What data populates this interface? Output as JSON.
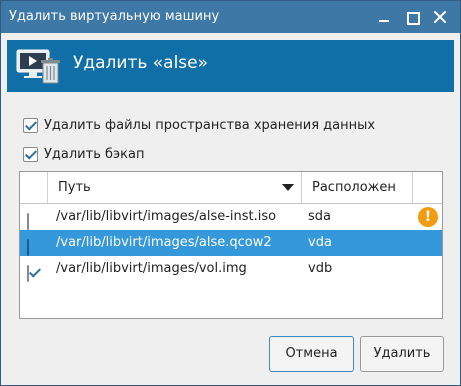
{
  "window": {
    "title": "Удалить виртуальную машину"
  },
  "header": {
    "title": "Удалить «alse»",
    "icon": "vm-delete-icon"
  },
  "options": [
    {
      "label": "Удалить файлы пространства хранения данных",
      "checked": true
    },
    {
      "label": "Удалить бэкап",
      "checked": true
    }
  ],
  "table": {
    "columns": [
      "Путь",
      "Расположен"
    ],
    "rows": [
      {
        "path": "/var/lib/libvirt/images/alse-inst.iso",
        "target": "sda",
        "checked": false,
        "selected": false,
        "warning": "!"
      },
      {
        "path": "/var/lib/libvirt/images/alse.qcow2",
        "target": "vda",
        "checked": false,
        "selected": true
      },
      {
        "path": "/var/lib/libvirt/images/vol.img",
        "target": "vdb",
        "checked": true,
        "selected": false
      }
    ]
  },
  "buttons": {
    "cancel": "Отмена",
    "delete": "Удалить"
  },
  "colors": {
    "titlebar": "#3e78a6",
    "header": "#0f6fa6",
    "selection": "#3498db",
    "warning": "#f39c12"
  }
}
